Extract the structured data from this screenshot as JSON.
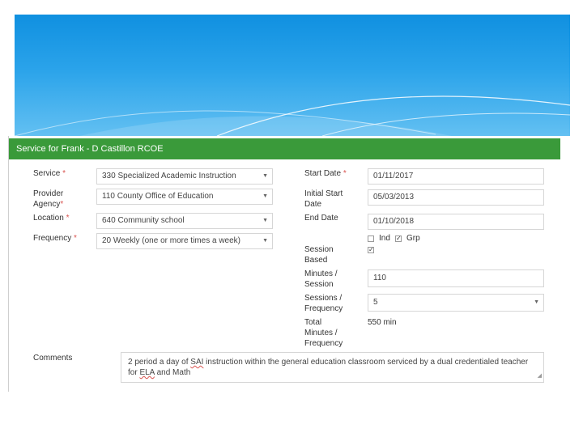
{
  "panel": {
    "title": "Service for Frank - D Castillon RCOE"
  },
  "left": {
    "service": {
      "label": "Service",
      "value": "330 Specialized Academic Instruction"
    },
    "provider": {
      "label_line1": "Provider",
      "label_line2": "Agency",
      "value": "110 County Office of Education"
    },
    "location": {
      "label": "Location",
      "value": "640 Community school"
    },
    "frequency": {
      "label": "Frequency",
      "value": "20 Weekly (one or more times a week)"
    }
  },
  "right": {
    "start_date": {
      "label": "Start Date",
      "value": "01/11/2017"
    },
    "initial_start": {
      "label_line1": "Initial Start",
      "label_line2": "Date",
      "value": "05/03/2013"
    },
    "end_date": {
      "label": "End Date",
      "value": "01/10/2018"
    },
    "ind_label": "Ind",
    "grp_label": "Grp",
    "session_based": {
      "label_line1": "Session",
      "label_line2": "Based"
    },
    "minutes_session": {
      "label_line1": "Minutes /",
      "label_line2": "Session",
      "value": "110"
    },
    "sessions_frequency": {
      "label_line1": "Sessions /",
      "label_line2": "Frequency",
      "value": "5"
    },
    "total": {
      "label_line1": "Total",
      "label_line2": "Minutes /",
      "label_line3": "Frequency",
      "value": "550 min"
    }
  },
  "comments": {
    "label": "Comments",
    "text_1": "2 period a day of ",
    "text_sai": "SAI",
    "text_2": " instruction within the general education classroom serviced by a dual credentialed teacher",
    "text_3": "for ",
    "text_ela": "ELA",
    "text_4": " and Math"
  },
  "symbols": {
    "required": "*",
    "caret": "▼",
    "check": "✓",
    "resize": "◢"
  },
  "colors": {
    "header_green": "#3a9a3a",
    "banner_blue": "#1090e0",
    "required_red": "#d9534f"
  }
}
